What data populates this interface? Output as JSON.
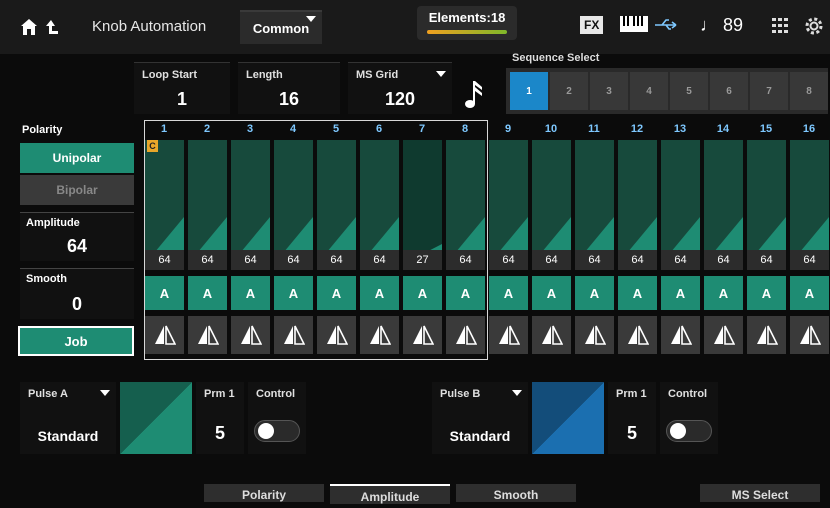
{
  "header": {
    "title": "Knob Automation",
    "part": "Common",
    "elements_label": "Elements:18",
    "fx_label": "FX",
    "tempo": "♩ 89"
  },
  "params": {
    "loop_start": {
      "label": "Loop Start",
      "value": "1"
    },
    "length": {
      "label": "Length",
      "value": "16"
    },
    "ms_grid": {
      "label": "MS Grid",
      "value": "120"
    }
  },
  "sequence_select": {
    "label": "Sequence Select",
    "items": [
      "1",
      "2",
      "3",
      "4",
      "5",
      "6",
      "7",
      "8"
    ],
    "active": "1"
  },
  "polarity": {
    "label": "Polarity",
    "unipolar": "Unipolar",
    "bipolar": "Bipolar",
    "selected": "Unipolar"
  },
  "amplitude": {
    "label": "Amplitude",
    "value": "64"
  },
  "smooth": {
    "label": "Smooth",
    "value": "0"
  },
  "job_label": "Job",
  "marker": "C",
  "steps": [
    {
      "num": "1",
      "value": "64",
      "type": "A"
    },
    {
      "num": "2",
      "value": "64",
      "type": "A"
    },
    {
      "num": "3",
      "value": "64",
      "type": "A"
    },
    {
      "num": "4",
      "value": "64",
      "type": "A"
    },
    {
      "num": "5",
      "value": "64",
      "type": "A"
    },
    {
      "num": "6",
      "value": "64",
      "type": "A"
    },
    {
      "num": "7",
      "value": "27",
      "type": "A"
    },
    {
      "num": "8",
      "value": "64",
      "type": "A"
    },
    {
      "num": "9",
      "value": "64",
      "type": "A"
    },
    {
      "num": "10",
      "value": "64",
      "type": "A"
    },
    {
      "num": "11",
      "value": "64",
      "type": "A"
    },
    {
      "num": "12",
      "value": "64",
      "type": "A"
    },
    {
      "num": "13",
      "value": "64",
      "type": "A"
    },
    {
      "num": "14",
      "value": "64",
      "type": "A"
    },
    {
      "num": "15",
      "value": "64",
      "type": "A"
    },
    {
      "num": "16",
      "value": "64",
      "type": "A"
    }
  ],
  "pulse_a": {
    "label": "Pulse A",
    "value": "Standard",
    "prm1_label": "Prm 1",
    "prm1_value": "5",
    "control_label": "Control",
    "control_on": false,
    "color": "#1e8c73"
  },
  "pulse_b": {
    "label": "Pulse B",
    "value": "Standard",
    "prm1_label": "Prm 1",
    "prm1_value": "5",
    "control_label": "Control",
    "control_on": false,
    "color": "#1b6fb0"
  },
  "tabs": [
    "Polarity",
    "Amplitude",
    "Smooth",
    "MS Select"
  ],
  "active_tab": "Amplitude",
  "colors": {
    "accent_green": "#1e8c73",
    "accent_blue": "#1b87c9"
  }
}
